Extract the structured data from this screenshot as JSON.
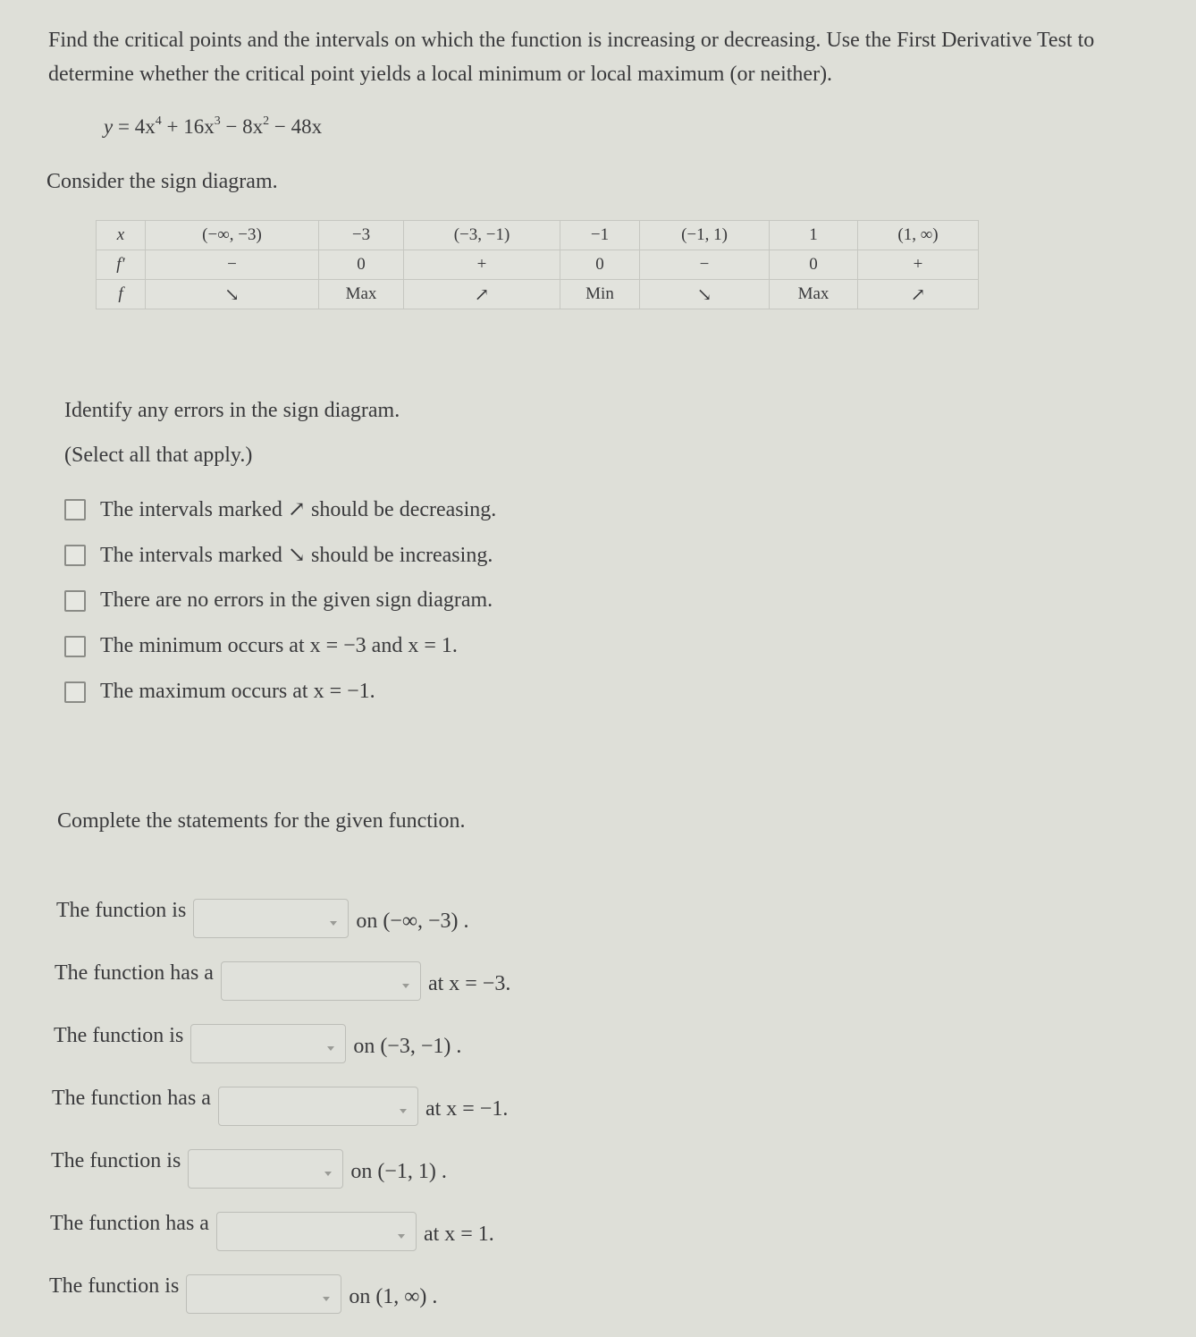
{
  "prompt": "Find the critical points and the intervals on which the function is increasing or decreasing. Use the First Derivative Test to determine whether the critical point yields a local minimum or local maximum (or neither).",
  "equation": {
    "lhs": "y",
    "terms": [
      "4x",
      "4",
      "16x",
      "3",
      "8x",
      "2",
      "48x"
    ],
    "display": "y = 4x^4 + 16x^3 − 8x^2 − 48x"
  },
  "consider_label": "Consider the sign diagram.",
  "sign_diagram": {
    "row_labels": [
      "x",
      "f′",
      "f"
    ],
    "columns": [
      {
        "x": "(−∞, −3)",
        "fprime": "−",
        "f": "↘",
        "f_icon": "arrow-down-right-icon"
      },
      {
        "x": "−3",
        "fprime": "0",
        "f": "Max"
      },
      {
        "x": "(−3, −1)",
        "fprime": "+",
        "f": "↗",
        "f_icon": "arrow-up-right-icon"
      },
      {
        "x": "−1",
        "fprime": "0",
        "f": "Min"
      },
      {
        "x": "(−1, 1)",
        "fprime": "−",
        "f": "↘",
        "f_icon": "arrow-down-right-icon"
      },
      {
        "x": "1",
        "fprime": "0",
        "f": "Max"
      },
      {
        "x": "(1, ∞)",
        "fprime": "+",
        "f": "↗",
        "f_icon": "arrow-up-right-icon"
      }
    ]
  },
  "identify_label": "Identify any errors in the sign diagram.",
  "select_all_label": "(Select all that apply.)",
  "options": [
    {
      "before": "The intervals marked ",
      "symbol": "↗",
      "after": " should be decreasing.",
      "checked": false
    },
    {
      "before": "The intervals marked ",
      "symbol": "↘",
      "after": " should be increasing.",
      "checked": false
    },
    {
      "before": "There are no errors in the given sign diagram.",
      "symbol": "",
      "after": "",
      "checked": false
    },
    {
      "before": "The minimum occurs at x = −3 and x = 1.",
      "symbol": "",
      "after": "",
      "checked": false
    },
    {
      "before": "The maximum occurs at x = −1.",
      "symbol": "",
      "after": "",
      "checked": false
    }
  ],
  "complete_label": "Complete the statements for the given function.",
  "statements": [
    {
      "lead": "The function is",
      "value": "",
      "tail": "on (−∞, −3) ."
    },
    {
      "lead": "The function has a",
      "value": "",
      "tail": "at x = −3."
    },
    {
      "lead": "The function is",
      "value": "",
      "tail": "on (−3, −1) ."
    },
    {
      "lead": "The function has a",
      "value": "",
      "tail": "at x = −1."
    },
    {
      "lead": "The function is",
      "value": "",
      "tail": "on (−1, 1) ."
    },
    {
      "lead": "The function has a",
      "value": "",
      "tail": "at x = 1."
    },
    {
      "lead": "The function is",
      "value": "",
      "tail": "on (1, ∞) ."
    }
  ]
}
